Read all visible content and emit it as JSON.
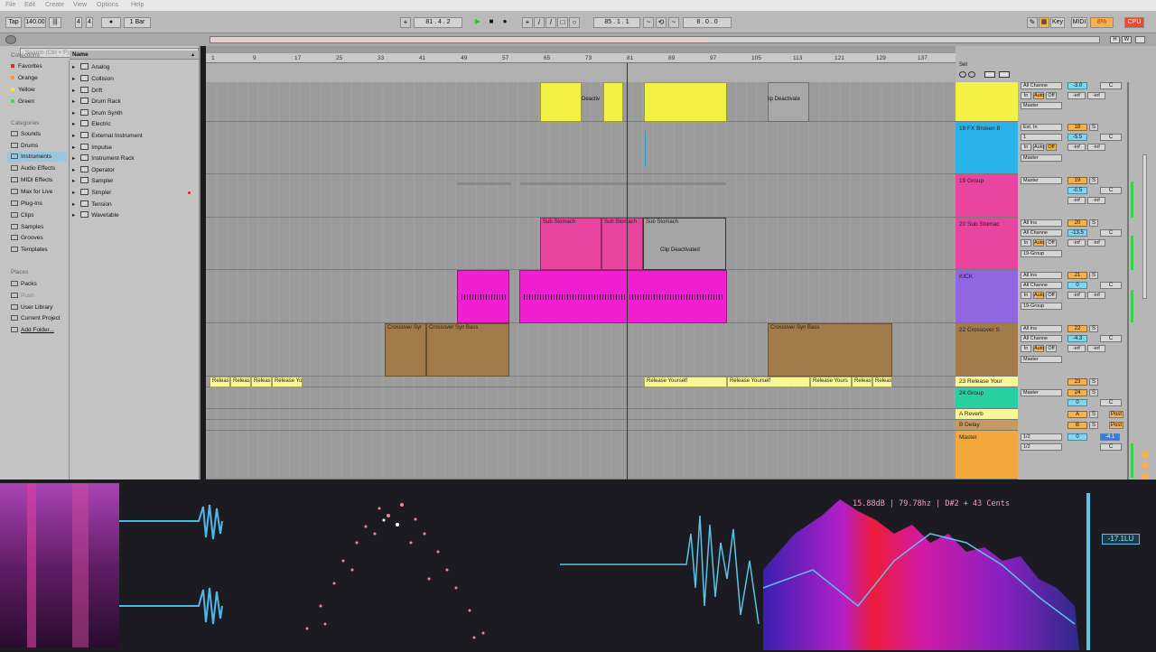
{
  "menu": {
    "items": [
      "File",
      "Edit",
      "Create",
      "View",
      "Options",
      "Help"
    ]
  },
  "transport": {
    "tap": "Tap",
    "tempo": "140.00",
    "time_sig_num": "4",
    "time_sig_den": "4",
    "metronome": "●",
    "quantize": "1 Bar",
    "position": "81 . 4 . 2",
    "loop_start": "85 . 1 . 1",
    "loop_length": "8 . 0 . 0",
    "key_label": "Key",
    "midi_label": "MIDI",
    "cpu_value": "8%",
    "cpu_label": "CPU",
    "hw_labels": [
      "H",
      "W"
    ]
  },
  "colors": {
    "yellow": "#f4f145",
    "blue": "#29b3e8",
    "pink": "#e9449f",
    "magenta": "#f01fd2",
    "purple": "#9067e0",
    "brown": "#a27b4a",
    "lightyellow": "#faf795",
    "teal": "#27cfa3",
    "orange": "#f3a83b",
    "accent_orange": "#f5b14b",
    "accent_cyan": "#7fd7ee"
  },
  "browser": {
    "search_placeholder": "Search (Ctrl + F)",
    "collections_header": "Collections",
    "collections": [
      {
        "label": "Favorites",
        "color": "#e52828"
      },
      {
        "label": "Orange",
        "color": "#f39a2a"
      },
      {
        "label": "Yellow",
        "color": "#f2e23a"
      },
      {
        "label": "Green",
        "color": "#3fd96b"
      }
    ],
    "categories_header": "Categories",
    "categories": [
      "Sounds",
      "Drums",
      "Instruments",
      "Audio Effects",
      "MIDI Effects",
      "Max for Live",
      "Plug-Ins",
      "Clips",
      "Samples",
      "Grooves",
      "Templates"
    ],
    "selected_category": "Instruments",
    "places_header": "Places",
    "places": [
      "Packs",
      "Push",
      "User Library",
      "Current Project",
      "Add Folder..."
    ],
    "name_header": "Name",
    "items": [
      "Analog",
      "Collision",
      "Drift",
      "Drum Rack",
      "Drum Synth",
      "Electric",
      "External Instrument",
      "Impulse",
      "Instrument Rack",
      "Operator",
      "Sampler",
      "Simpler",
      "Tension",
      "Wavetable"
    ]
  },
  "ruler": {
    "bars": [
      "1",
      "9",
      "17",
      "25",
      "33",
      "41",
      "49",
      "57",
      "65",
      "73",
      "81",
      "89",
      "97",
      "105",
      "113",
      "121",
      "129",
      "137"
    ]
  },
  "set_label": "Set",
  "clips": {
    "deactivated_a": "Deactiv",
    "deactivated_b": "lip Deactivate",
    "sub_stomach_1": "Sub Stomach",
    "sub_stomach_2": "Sub Stomach",
    "sub_stomach_3": "Sub Stomach",
    "clip_deactivated": "Clip Deactivated",
    "crossover_1": "Crossover Syr",
    "crossover_2": "Crossover Syn Bass",
    "crossover_3": "Crossover Syn Bass",
    "release_1": "Releas",
    "release_2": "Releas",
    "release_3": "Releas",
    "release_4": "Release Yo",
    "release_5": "Release Yourself",
    "release_6": "Release Yourself",
    "release_7": "Release Yours",
    "release_8": "Releas",
    "release_9": "Releas"
  },
  "tracks": [
    {
      "name": "",
      "number": "",
      "volume": "-3.0",
      "io": [
        "All Channe",
        "",
        "Master"
      ],
      "monitor": [
        "In",
        "Auto",
        "Off"
      ]
    },
    {
      "name": "18 FX Broken 8",
      "number": "18",
      "volume": "-5.5",
      "io": [
        "Ext. In",
        "1",
        "Master"
      ],
      "monitor": [
        "In",
        "Auto",
        "Off"
      ]
    },
    {
      "name": "19 Group",
      "number": "19",
      "volume": "-0.5",
      "io": [
        "Master"
      ]
    },
    {
      "name": "20 Sub Stomac",
      "number": "20",
      "volume": "-13.5",
      "io": [
        "All Ins",
        "All Channe",
        "19-Group"
      ],
      "monitor": [
        "In",
        "Auto",
        "Off"
      ]
    },
    {
      "name": "KICK",
      "number": "21",
      "volume": "0",
      "io": [
        "All Ins",
        "All Channe",
        "19-Group"
      ],
      "monitor": [
        "In",
        "Auto",
        "Off"
      ]
    },
    {
      "name": "22 Crossover S",
      "number": "22",
      "volume": "-4.3",
      "io": [
        "All Ins",
        "All Channe",
        "Master"
      ],
      "monitor": [
        "In",
        "Auto",
        "Off"
      ]
    },
    {
      "name": "23 Release Your",
      "number": "23"
    },
    {
      "name": "24 Group",
      "number": "24",
      "volume": "0",
      "io": [
        "Master"
      ]
    },
    {
      "name": "A Reverb",
      "number": "A",
      "post": "Post"
    },
    {
      "name": "B Delay",
      "number": "B",
      "post": "Post"
    },
    {
      "name": "Master",
      "number": "0",
      "volume": "-4.1",
      "io": [
        "1/2",
        "1/2"
      ]
    }
  ],
  "mixer_common": {
    "solo": "S",
    "pan": "C",
    "inf": "-inf"
  },
  "visualizer": {
    "readout": "15.88dB | 79.78hz | D#2 + 43 Cents",
    "level": "-17.1LU"
  }
}
